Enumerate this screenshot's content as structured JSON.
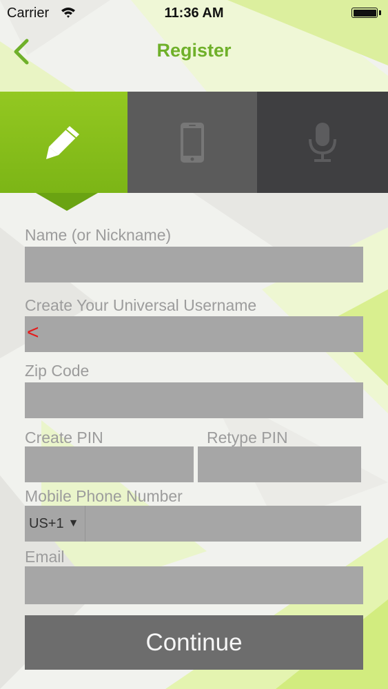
{
  "status_bar": {
    "carrier": "Carrier",
    "time": "11:36 AM"
  },
  "nav": {
    "title": "Register",
    "back_icon": "chevron-left-icon"
  },
  "tabs": [
    {
      "icon": "pencil-icon",
      "active": true
    },
    {
      "icon": "smartphone-icon",
      "active": false
    },
    {
      "icon": "microphone-icon",
      "active": false
    }
  ],
  "form": {
    "name_label": "Name (or Nickname)",
    "name_value": "",
    "username_label": "Create Your Universal Username",
    "username_value": "",
    "username_marker": "<",
    "zip_label": "Zip Code",
    "zip_value": "",
    "pin_label": "Create PIN",
    "pin_value": "",
    "retype_pin_label": "Retype PIN",
    "retype_pin_value": "",
    "phone_label": "Mobile Phone Number",
    "country_code": "US+1",
    "country_caret": "▼",
    "phone_value": "",
    "email_label": "Email",
    "email_value": "",
    "continue_label": "Continue"
  },
  "colors": {
    "accent_green": "#6fb02a",
    "tab_active": "#8bc11c",
    "tab_mid": "#5b5b5b",
    "tab_dark": "#3f3f41",
    "field_bg": "#a6a6a6",
    "button_bg": "#6d6d6d",
    "error_marker": "#e41b1b"
  }
}
